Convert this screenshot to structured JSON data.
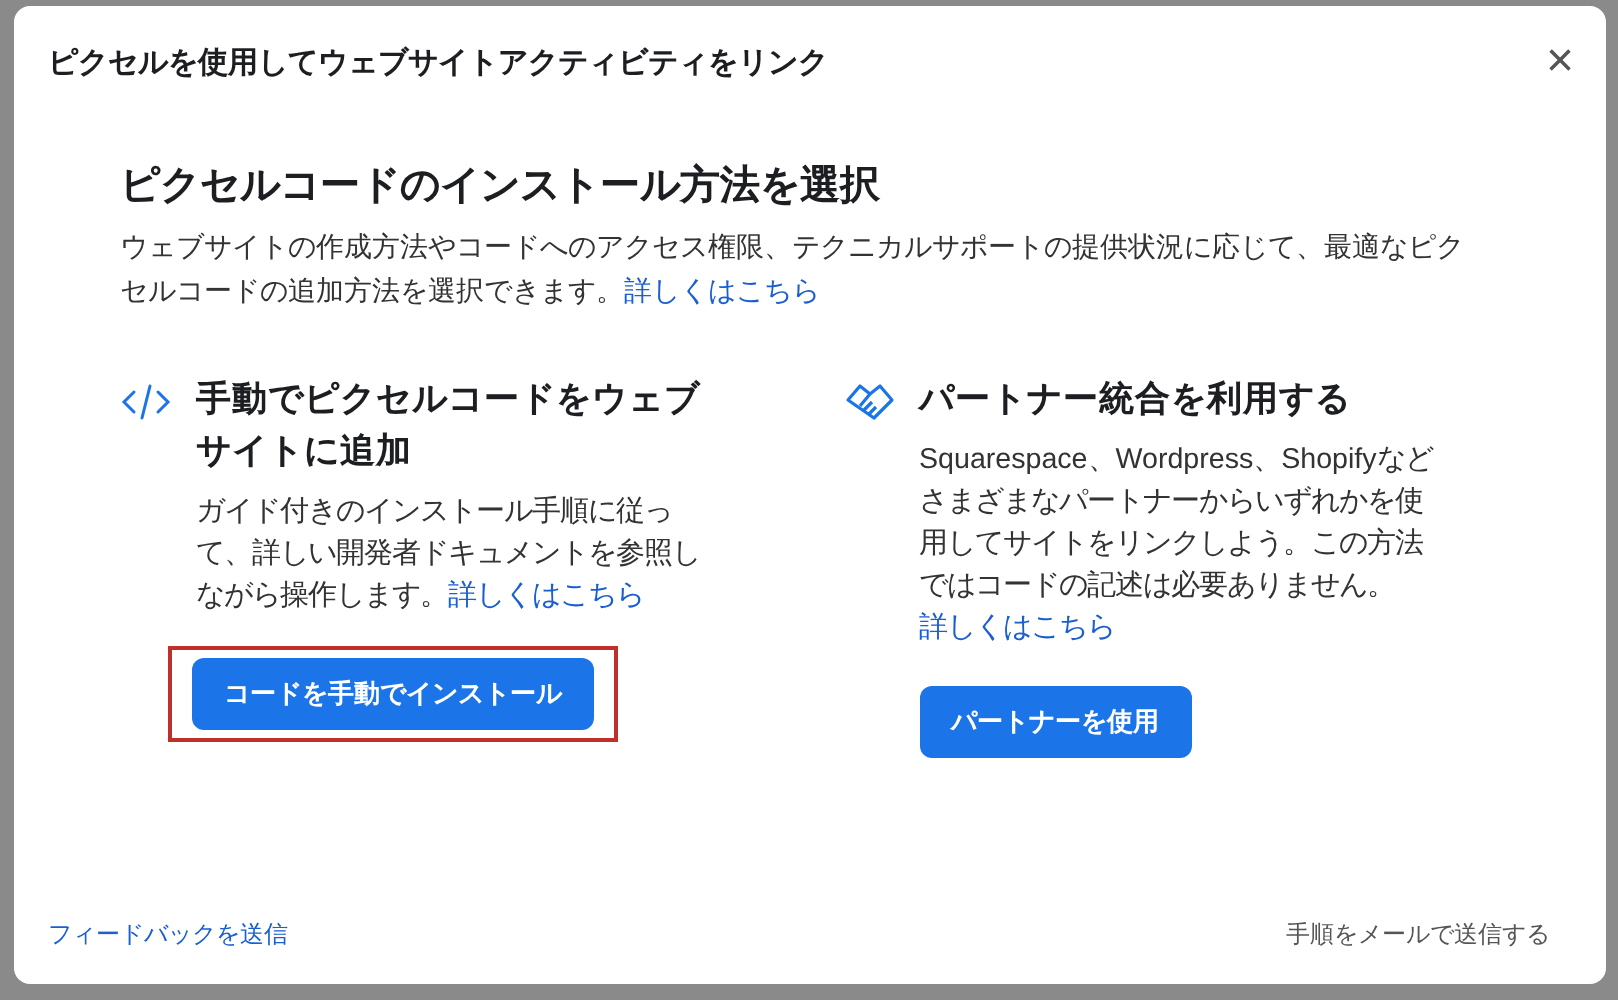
{
  "dialog": {
    "title": "ピクセルを使用してウェブサイトアクティビティをリンク",
    "close": "×"
  },
  "heading": "ピクセルコードのインストール方法を選択",
  "intro": {
    "text": "ウェブサイトの作成方法やコードへのアクセス権限、テクニカルサポートの提供状況に応じて、最適なピクセルコードの追加方法を選択できます。",
    "link": "詳しくはこちら"
  },
  "options": [
    {
      "kind": "code",
      "title": "手動でピクセルコードをウェブサイトに追加",
      "text": "ガイド付きのインストール手順に従って、詳しい開発者ドキュメントを参照しながら操作します。",
      "link": "詳しくはこちら",
      "button": "コードを手動でインストール",
      "highlighted": true
    },
    {
      "kind": "partner",
      "title": "パートナー統合を利用する",
      "text": "Squarespace、Wordpress、Shopifyなどさまざまなパートナーからいずれかを使用してサイトをリンクしよう。この方法ではコードの記述は必要ありません。",
      "link": "詳しくはこちら",
      "button": "パートナーを使用",
      "highlighted": false
    }
  ],
  "footer": {
    "feedback": "フィードバックを送信",
    "email": "手順をメールで送信する"
  }
}
